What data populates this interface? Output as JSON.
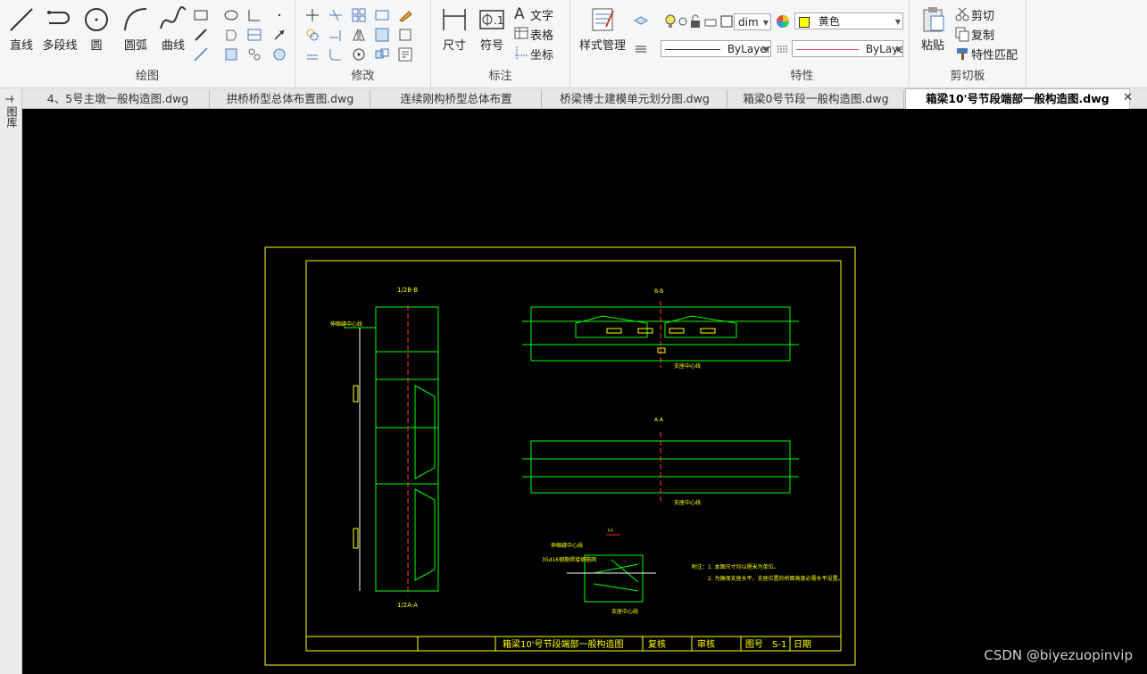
{
  "ribbon": {
    "draw": {
      "title": "绘图",
      "line": "直线",
      "polyline": "多段线",
      "circle": "圆",
      "arc": "圆弧",
      "curve": "曲线"
    },
    "modify": {
      "title": "修改"
    },
    "annotate": {
      "title": "标注",
      "dimension": "尺寸",
      "symbol": "符号",
      "text": "文字",
      "table": "表格",
      "coordinate": "坐标"
    },
    "style": {
      "label": "样式管理"
    },
    "properties": {
      "title": "特性",
      "layer": "dim",
      "color": "黄色",
      "linetype": "ByLayer",
      "lineweight": "ByLayer",
      "color_swatch": "#ffff00"
    },
    "clipboard": {
      "title": "剪切板",
      "paste": "粘贴",
      "cut": "剪切",
      "copy": "复制",
      "match": "特性匹配"
    }
  },
  "tabs": [
    {
      "label": "4、5号主墩一般构造图.dwg"
    },
    {
      "label": "拱桥桥型总体布置图.dwg"
    },
    {
      "label": "连续刚构桥型总体布置"
    },
    {
      "label": "桥梁博士建模单元划分图.dwg"
    },
    {
      "label": "箱梁0号节段一般构造图.dwg"
    },
    {
      "label": "箱梁10'号节段端部一般构造图.dwg"
    }
  ],
  "sidebar": {
    "label": "图库"
  },
  "drawing": {
    "title_block": {
      "title": "箱梁10'号节段端部一般构造图",
      "review": "复核",
      "audit": "审核",
      "drawing_no": "图号",
      "sheet": "S-1",
      "date": "日期"
    },
    "view_top": "1/2B-B",
    "view_bottom": "1/2A-A",
    "view_section1": "B-B",
    "view_section2": "A-A",
    "view_detail": "I-I",
    "centerline_label": "伸缩缝中心线",
    "support_label": "支座中心线",
    "bolt_note": "35d16钢筋焊接钢筋网",
    "notes": [
      "附注：1. 本图尺寸均以厘米为单位。",
      "2. 为确保支座水平，支座位置的桥面高度必需水平设置。"
    ]
  },
  "watermark": "CSDN @biyezuopinvip"
}
